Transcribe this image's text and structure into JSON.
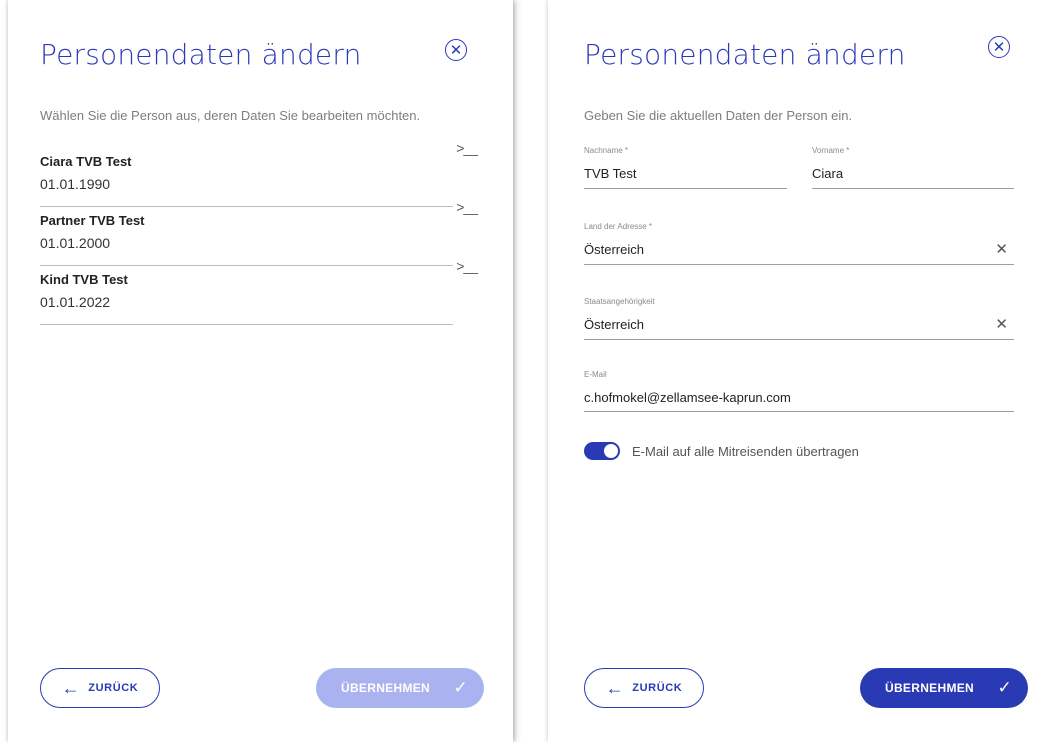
{
  "colors": {
    "primary": "#2a3ab5",
    "primary_disabled": "#aab3ef",
    "divider": "#bdbdbd"
  },
  "left_panel": {
    "title": "Personendaten ändern",
    "close_icon": "close-icon",
    "subtitle": "Wählen Sie die Person aus, deren Daten Sie bearbeiten möchten.",
    "persons": [
      {
        "name": "Ciara TVB Test",
        "dob": "01.01.1990"
      },
      {
        "name": "Partner TVB Test",
        "dob": "01.01.2000"
      },
      {
        "name": "Kind TVB Test",
        "dob": "01.01.2022"
      }
    ],
    "back_label": "ZURÜCK",
    "apply_label": "ÜBERNEHMEN",
    "apply_enabled": false
  },
  "right_panel": {
    "title": "Personendaten ändern",
    "close_icon": "close-icon",
    "subtitle": "Geben Sie die aktuellen Daten der Person ein.",
    "fields": {
      "lastname": {
        "label": "Nachname *",
        "value": "TVB Test"
      },
      "firstname": {
        "label": "Vorname *",
        "value": "Ciara"
      },
      "country": {
        "label": "Land der Adresse *",
        "value": "Österreich"
      },
      "nationality": {
        "label": "Staatsangehörigkeit",
        "value": "Österreich"
      },
      "email": {
        "label": "E-Mail",
        "value": "c.hofmokel@zellamsee-kaprun.com"
      }
    },
    "toggle": {
      "label": "E-Mail auf alle Mitreisenden übertragen",
      "on": true
    },
    "back_label": "ZURÜCK",
    "apply_label": "ÜBERNEHMEN",
    "apply_enabled": true
  }
}
